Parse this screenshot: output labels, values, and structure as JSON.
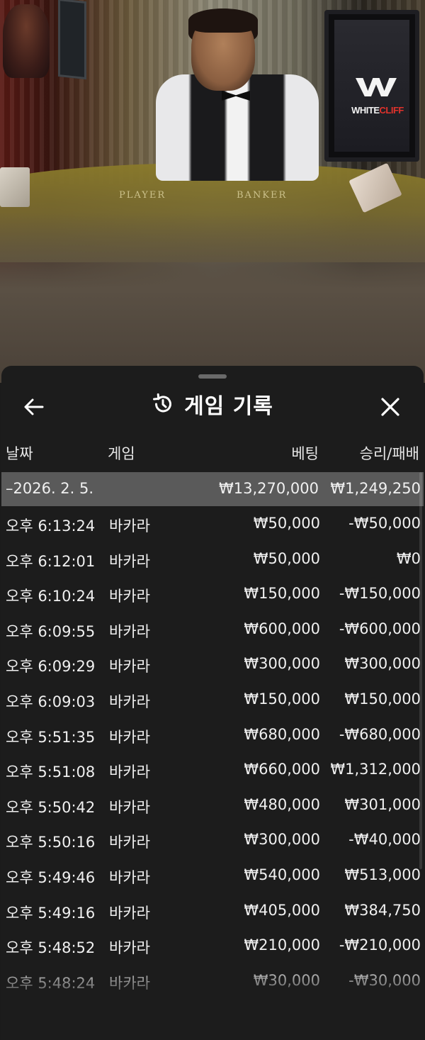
{
  "video": {
    "felt_labels": [
      "PLAYER",
      "BANKER"
    ],
    "brand": {
      "part1": "WHITE",
      "part2": "CLIFF"
    }
  },
  "header": {
    "title": "게임 기록",
    "back_icon": "arrow-left-icon",
    "history_icon": "history-clock-icon",
    "close_icon": "close-x-icon"
  },
  "columns": {
    "date": "날짜",
    "game": "게임",
    "bet": "베팅",
    "result": "승리/패배"
  },
  "summary": {
    "date": "–2026. 2. 5.",
    "bet": "₩13,270,000",
    "result": "₩1,249,250"
  },
  "rows": [
    {
      "time": "오후 6:13:24",
      "game": "바카라",
      "bet": "₩50,000",
      "result": "-₩50,000"
    },
    {
      "time": "오후 6:12:01",
      "game": "바카라",
      "bet": "₩50,000",
      "result": "₩0"
    },
    {
      "time": "오후 6:10:24",
      "game": "바카라",
      "bet": "₩150,000",
      "result": "-₩150,000"
    },
    {
      "time": "오후 6:09:55",
      "game": "바카라",
      "bet": "₩600,000",
      "result": "-₩600,000"
    },
    {
      "time": "오후 6:09:29",
      "game": "바카라",
      "bet": "₩300,000",
      "result": "₩300,000"
    },
    {
      "time": "오후 6:09:03",
      "game": "바카라",
      "bet": "₩150,000",
      "result": "₩150,000"
    },
    {
      "time": "오후 5:51:35",
      "game": "바카라",
      "bet": "₩680,000",
      "result": "-₩680,000"
    },
    {
      "time": "오후 5:51:08",
      "game": "바카라",
      "bet": "₩660,000",
      "result": "₩1,312,000"
    },
    {
      "time": "오후 5:50:42",
      "game": "바카라",
      "bet": "₩480,000",
      "result": "₩301,000"
    },
    {
      "time": "오후 5:50:16",
      "game": "바카라",
      "bet": "₩300,000",
      "result": "-₩40,000"
    },
    {
      "time": "오후 5:49:46",
      "game": "바카라",
      "bet": "₩540,000",
      "result": "₩513,000"
    },
    {
      "time": "오후 5:49:16",
      "game": "바카라",
      "bet": "₩405,000",
      "result": "₩384,750"
    },
    {
      "time": "오후 5:48:52",
      "game": "바카라",
      "bet": "₩210,000",
      "result": "-₩210,000"
    },
    {
      "time": "오후 5:48:24",
      "game": "바카라",
      "bet": "₩30,000",
      "result": "-₩30,000"
    }
  ]
}
